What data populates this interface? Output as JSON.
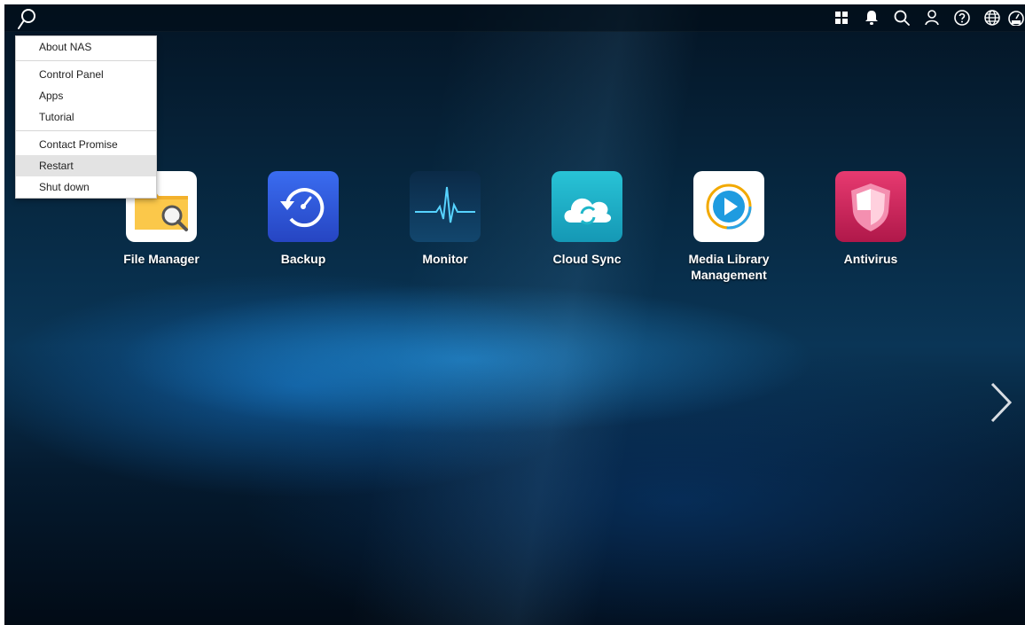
{
  "menu": {
    "items": [
      {
        "label": "About NAS"
      },
      {
        "label": "Control Panel"
      },
      {
        "label": "Apps"
      },
      {
        "label": "Tutorial"
      },
      {
        "label": "Contact Promise"
      },
      {
        "label": "Restart",
        "highlighted": true
      },
      {
        "label": "Shut down"
      }
    ]
  },
  "topbar": {
    "logo_icon": "promise-logo-icon",
    "icons": [
      "apps-grid-icon",
      "notification-bell-icon",
      "search-icon",
      "user-icon",
      "help-icon",
      "language-globe-icon",
      "dashboard-gauge-icon"
    ]
  },
  "apps": [
    {
      "label": "File Manager",
      "icon": "file-manager-icon",
      "color": "#f5b731"
    },
    {
      "label": "Backup",
      "icon": "backup-icon",
      "color": "#2f55d4"
    },
    {
      "label": "Monitor",
      "icon": "monitor-icon",
      "color": "#0e3a5c"
    },
    {
      "label": "Cloud Sync",
      "icon": "cloud-sync-icon",
      "color": "#1fb6c9"
    },
    {
      "label": "Media Library Management",
      "icon": "media-library-icon",
      "color": "#ffffff"
    },
    {
      "label": "Antivirus",
      "icon": "antivirus-icon",
      "color": "#d0245a"
    }
  ],
  "navigation": {
    "next_icon": "chevron-right-icon"
  }
}
